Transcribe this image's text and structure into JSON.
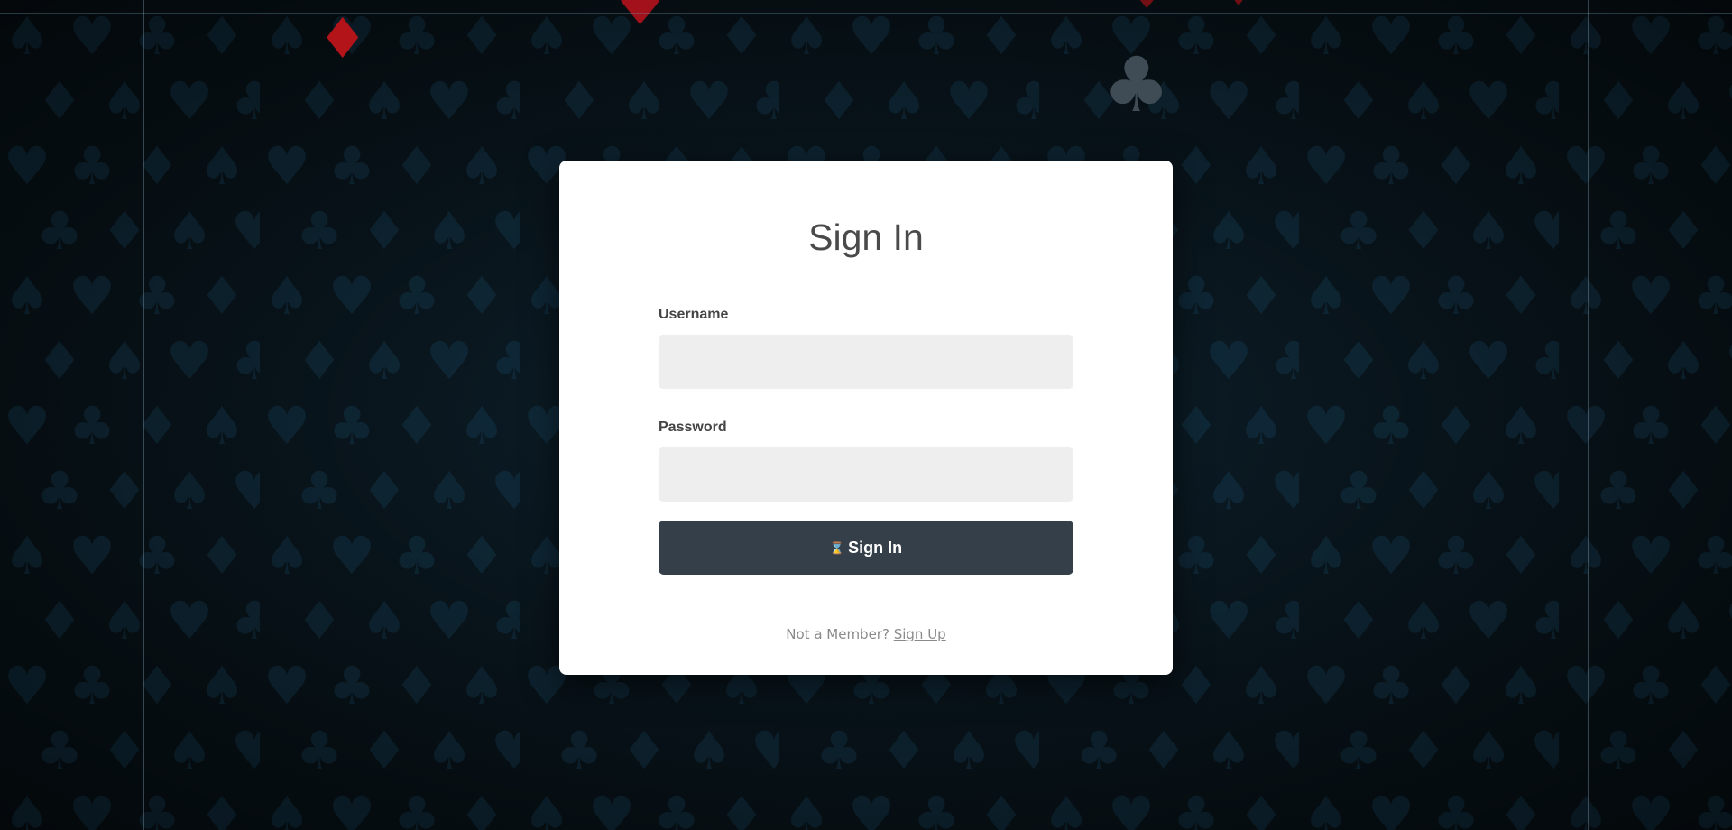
{
  "background": {
    "pattern_suits": [
      "spade",
      "heart",
      "club",
      "diamond"
    ],
    "base_color": "#0a1820",
    "pattern_color": "#123448",
    "accent_suit_color": "#b3141a",
    "accent_club_color": "#3f4c56"
  },
  "login": {
    "title": "Sign In",
    "username_label": "Username",
    "username_value": "",
    "password_label": "Password",
    "password_value": "",
    "submit_icon": "hourglass-icon",
    "submit_label": "Sign In",
    "footer_prompt": "Not a Member?",
    "signup_link": "Sign Up"
  },
  "colors": {
    "card_background": "#ffffff",
    "input_background": "#eeeeee",
    "button_background": "#343f49",
    "title_color": "#4a4a4a"
  }
}
